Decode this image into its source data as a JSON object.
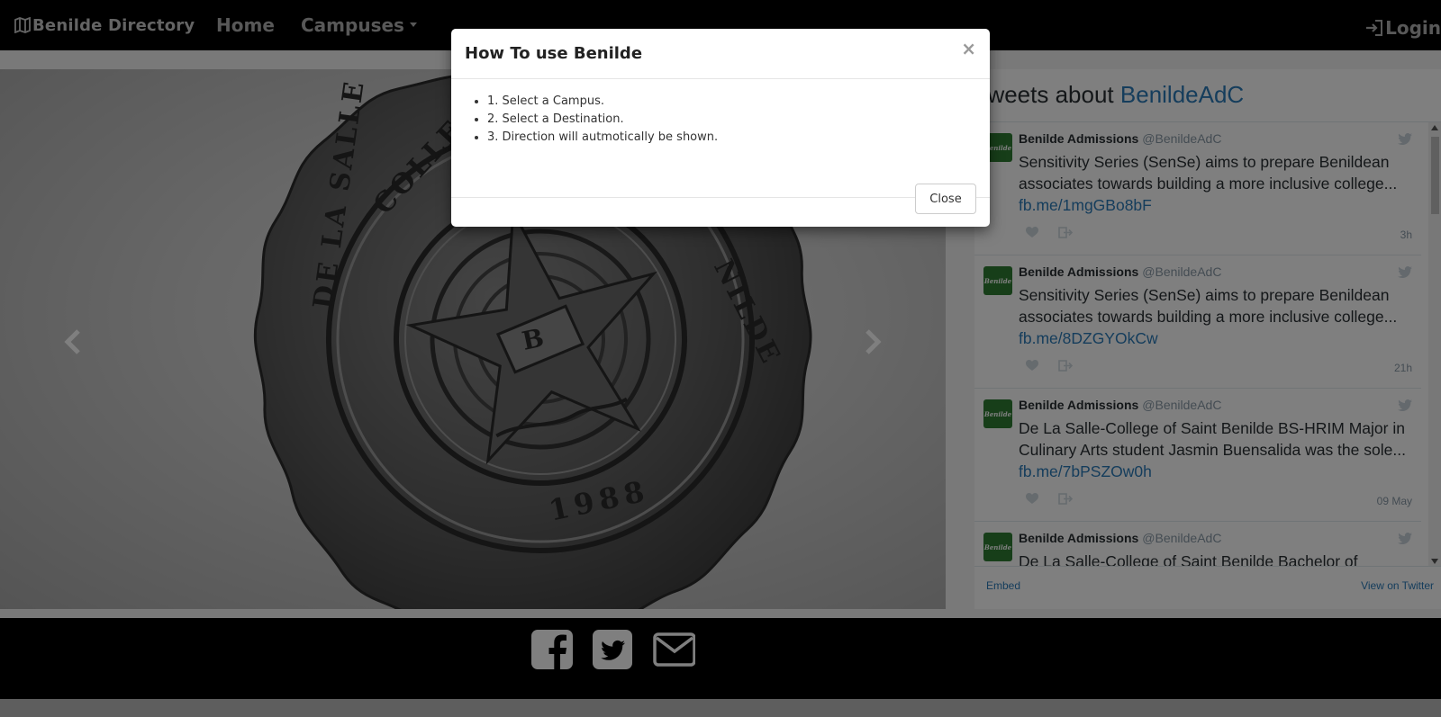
{
  "navbar": {
    "brand": "Benilde Directory",
    "brand_icon": "map-icon",
    "home_label": "Home",
    "campuses_label": "Campuses",
    "login_label": "Login",
    "login_icon": "sign-in-icon"
  },
  "carousel": {
    "image": "De La Salle College of Saint Benilde seal",
    "seal_text_top": "DE LA SALLE COLLEGE OF SAINT BENILDE",
    "seal_year": "1988",
    "indicator_count": 4,
    "active_indicator": 1,
    "prev_icon": "chevron-left-icon",
    "next_icon": "chevron-right-icon"
  },
  "twitter": {
    "header_prefix": "Tweets about ",
    "header_account": "BenildeAdC",
    "embed_label": "Embed",
    "view_label": "View on Twitter",
    "tweets": [
      {
        "name": "Benilde Admissions",
        "handle": "@BenildeAdC",
        "text": "Sensitivity Series (SenSe) aims to prepare Benildean associates towards building a more inclusive college... ",
        "link": "fb.me/1mgGBo8bF",
        "time": "3h"
      },
      {
        "name": "Benilde Admissions",
        "handle": "@BenildeAdC",
        "text": "Sensitivity Series (SenSe) aims to prepare Benildean associates towards building a more inclusive college... ",
        "link": "fb.me/8DZGYOkCw",
        "time": "21h"
      },
      {
        "name": "Benilde Admissions",
        "handle": "@BenildeAdC",
        "text": "De La Salle-College of Saint Benilde BS-HRIM Major in Culinary Arts student Jasmin Buensalida was the sole... ",
        "link": "fb.me/7bPSZOw0h",
        "time": "09 May"
      },
      {
        "name": "Benilde Admissions",
        "handle": "@BenildeAdC",
        "text": "De La Salle-College of Saint Benilde Bachelor of",
        "link": "",
        "time": ""
      }
    ],
    "avatar_text": "Benilde"
  },
  "footer": {
    "icons": [
      "facebook-icon",
      "twitter-icon",
      "envelope-icon"
    ]
  },
  "modal": {
    "title": "How To use Benilde",
    "close_x": "×",
    "steps": [
      "1. Select a Campus.",
      "2. Select a Destination.",
      "3. Direction will autmotically be shown."
    ],
    "close_button": "Close"
  },
  "colors": {
    "navbar_bg": "#000000",
    "twitter_link": "#2b7bb9",
    "avatar_green": "#2e7d32",
    "modal_bg": "#ffffff"
  }
}
